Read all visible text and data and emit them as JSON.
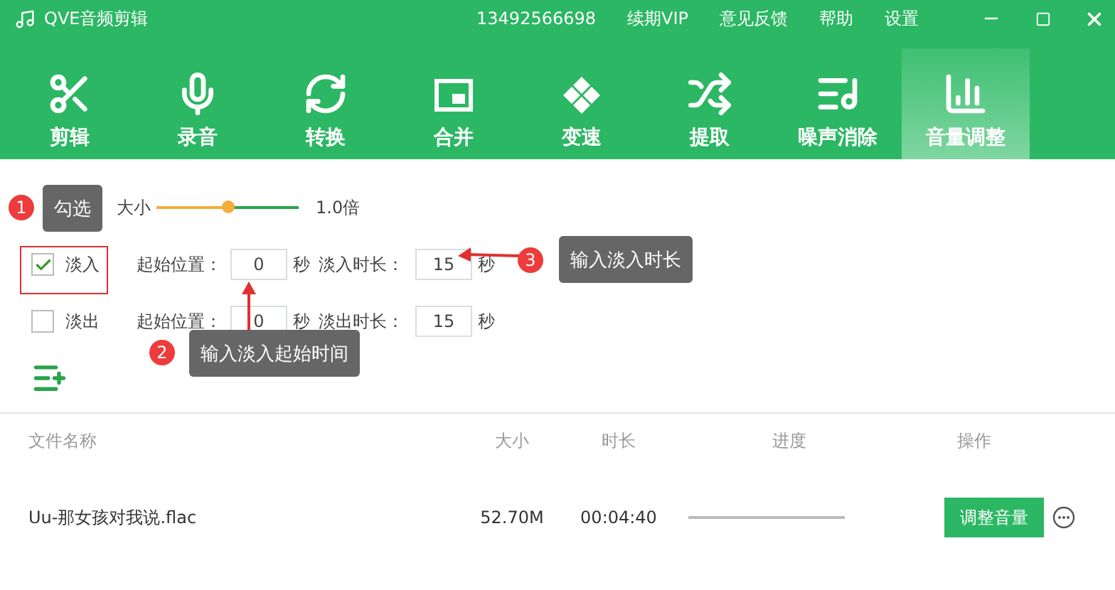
{
  "window": {
    "title": "QVE音频剪辑",
    "phone": "13492566698",
    "links": [
      "续期VIP",
      "意见反馈",
      "帮助",
      "设置"
    ]
  },
  "tabs": [
    {
      "label": "剪辑",
      "selected": false
    },
    {
      "label": "录音",
      "selected": false
    },
    {
      "label": "转换",
      "selected": false
    },
    {
      "label": "合并",
      "selected": false
    },
    {
      "label": "变速",
      "selected": false
    },
    {
      "label": "提取",
      "selected": false
    },
    {
      "label": "噪声消除",
      "selected": false
    },
    {
      "label": "音量调整",
      "selected": true
    }
  ],
  "volume": {
    "label": "大小",
    "level": 0.5,
    "reading": "1.0倍"
  },
  "fades": [
    {
      "label": "淡入",
      "checked": true,
      "start_label": "起始位置：",
      "start": "0",
      "unit": "秒",
      "duration_label": "淡入时长：",
      "duration": "15",
      "duration_unit": "秒"
    },
    {
      "label": "淡出",
      "checked": false,
      "start_label": "起始位置：",
      "start": "0",
      "unit": "秒",
      "duration_label": "淡出时长：",
      "duration": "15",
      "duration_unit": "秒"
    }
  ],
  "table": {
    "columns": [
      "文件名称",
      "大小",
      "时长",
      "进度",
      "操作"
    ],
    "rows": [
      {
        "name": "Uu-那女孩对我说.flac",
        "size": "52.70M",
        "duration": "00:04:40",
        "level": 0,
        "action": "调整音量"
      }
    ]
  },
  "annotations": [
    {
      "number": "1",
      "text": "勾选"
    },
    {
      "number": "2",
      "text": "输入淡入起始时间"
    },
    {
      "number": "3",
      "text": "输入淡入时长"
    }
  ]
}
